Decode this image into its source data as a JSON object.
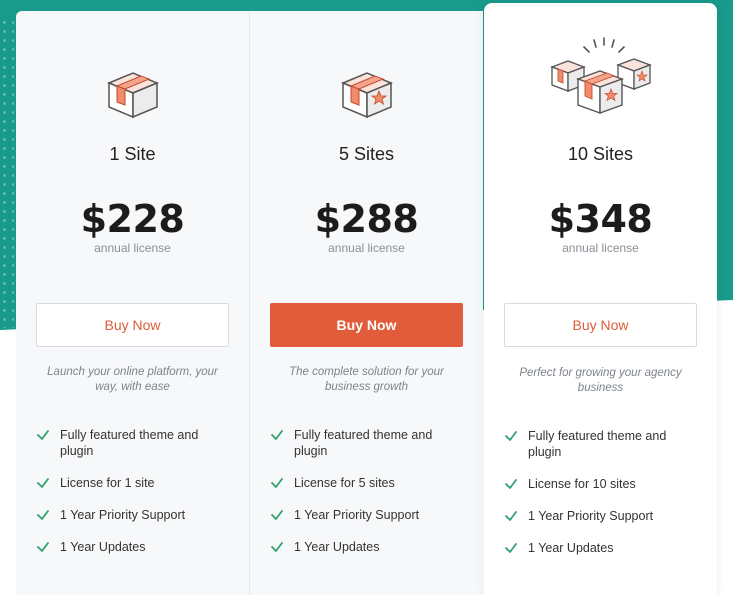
{
  "colors": {
    "accent": "#e05c3a",
    "teal_background": "#1a9a8a",
    "check": "#2fa36b"
  },
  "plans": [
    {
      "icon": "package-box-icon",
      "name": "1 Site",
      "price": "$228",
      "license": "annual license",
      "button": "Buy Now",
      "tagline": "Launch your online platform, your way, with ease",
      "features": [
        "Fully featured theme and plugin",
        "License for 1 site",
        "1 Year Priority Support",
        "1 Year Updates"
      ]
    },
    {
      "icon": "package-box-star-icon",
      "name": "5 Sites",
      "price": "$288",
      "license": "annual license",
      "button": "Buy Now",
      "tagline": "The complete solution for your business growth",
      "features": [
        "Fully featured theme and plugin",
        "License for 5 sites",
        "1 Year Priority Support",
        "1 Year Updates"
      ]
    },
    {
      "icon": "multiple-packages-icon",
      "name": "10 Sites",
      "price": "$348",
      "license": "annual license",
      "button": "Buy Now",
      "tagline": "Perfect for growing your agency business",
      "features": [
        "Fully featured theme and plugin",
        "License for 10 sites",
        "1 Year Priority Support",
        "1 Year Updates"
      ]
    }
  ]
}
